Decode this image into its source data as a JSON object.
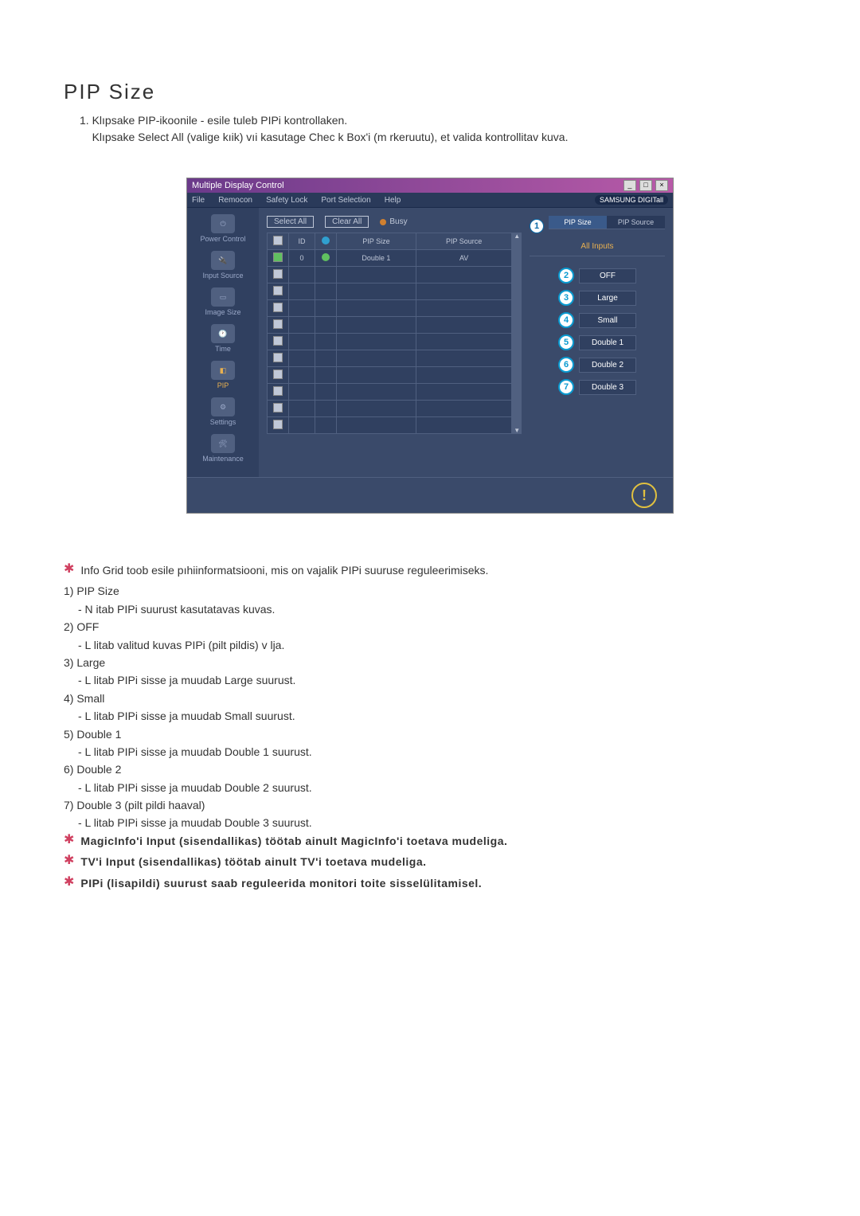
{
  "title": "PIP Size",
  "intro": {
    "num": "1.",
    "line1": "Klıpsake PIP-ikoonile - esile tuleb PIPi kontrollaken.",
    "line2": "Klıpsake Select All (valige kıik) vıi kasutage Chec k Box'i (m rkeruutu), et valida kontrollitav kuva."
  },
  "app": {
    "window_title": "Multiple Display Control",
    "menu": [
      "File",
      "Remocon",
      "Safety Lock",
      "Port Selection",
      "Help"
    ],
    "brand": "SAMSUNG DIGITall",
    "sidebar": [
      {
        "label": "Power Control"
      },
      {
        "label": "Input Source"
      },
      {
        "label": "Image Size"
      },
      {
        "label": "Time"
      },
      {
        "label": "PIP",
        "active": true
      },
      {
        "label": "Settings"
      },
      {
        "label": "Maintenance"
      }
    ],
    "topbtns": {
      "select_all": "Select All",
      "clear_all": "Clear All",
      "busy": "Busy"
    },
    "grid": {
      "headers": [
        "",
        "ID",
        "",
        "PIP Size",
        "PIP Source"
      ],
      "rows": [
        {
          "checked": true,
          "id": "0",
          "status": "green",
          "pip_size": "Double 1",
          "pip_source": "AV"
        },
        {
          "checked": false,
          "id": "",
          "status": "",
          "pip_size": "",
          "pip_source": ""
        },
        {
          "checked": false,
          "id": "",
          "status": "",
          "pip_size": "",
          "pip_source": ""
        },
        {
          "checked": false,
          "id": "",
          "status": "",
          "pip_size": "",
          "pip_source": ""
        },
        {
          "checked": false,
          "id": "",
          "status": "",
          "pip_size": "",
          "pip_source": ""
        },
        {
          "checked": false,
          "id": "",
          "status": "",
          "pip_size": "",
          "pip_source": ""
        },
        {
          "checked": false,
          "id": "",
          "status": "",
          "pip_size": "",
          "pip_source": ""
        },
        {
          "checked": false,
          "id": "",
          "status": "",
          "pip_size": "",
          "pip_source": ""
        },
        {
          "checked": false,
          "id": "",
          "status": "",
          "pip_size": "",
          "pip_source": ""
        },
        {
          "checked": false,
          "id": "",
          "status": "",
          "pip_size": "",
          "pip_source": ""
        },
        {
          "checked": false,
          "id": "",
          "status": "",
          "pip_size": "",
          "pip_source": ""
        }
      ]
    },
    "right": {
      "tabs": [
        {
          "n": "1",
          "label": "PIP Size"
        },
        {
          "label": "PIP Source"
        }
      ],
      "all_inputs": "All Inputs",
      "options": [
        {
          "n": "2",
          "label": "OFF"
        },
        {
          "n": "3",
          "label": "Large"
        },
        {
          "n": "4",
          "label": "Small"
        },
        {
          "n": "5",
          "label": "Double 1"
        },
        {
          "n": "6",
          "label": "Double 2"
        },
        {
          "n": "7",
          "label": "Double 3"
        }
      ]
    }
  },
  "notes": {
    "star_intro": "Info Grid toob esile pıhiinformatsiooni, mis on vajalik PIPi suuruse reguleerimiseks.",
    "items": [
      {
        "h": "1) PIP Size",
        "d": "- N itab PIPi suurust kasutatavas kuvas."
      },
      {
        "h": "2) OFF",
        "d": "- L litab valitud kuvas PIPi (pilt pildis) v lja."
      },
      {
        "h": "3) Large",
        "d": "- L litab PIPi sisse ja muudab Large suurust."
      },
      {
        "h": "4) Small",
        "d": "- L litab PIPi sisse ja muudab Small suurust."
      },
      {
        "h": "5) Double 1",
        "d": "- L litab PIPi sisse ja muudab Double 1 suurust."
      },
      {
        "h": "6) Double 2",
        "d": "- L litab PIPi sisse ja muudab Double 2 suurust."
      },
      {
        "h": "7) Double 3 (pilt pildi haaval)",
        "d": "- L litab PIPi sisse ja muudab Double 3 suurust."
      }
    ],
    "stars": [
      "MagicInfo'i Input (sisendallikas) töötab ainult MagicInfo'i toetava mudeliga.",
      "TV'i Input (sisendallikas) töötab ainult TV'i toetava mudeliga.",
      "PIPi (lisapildi) suurust saab reguleerida monitori toite sisselülitamisel."
    ]
  }
}
